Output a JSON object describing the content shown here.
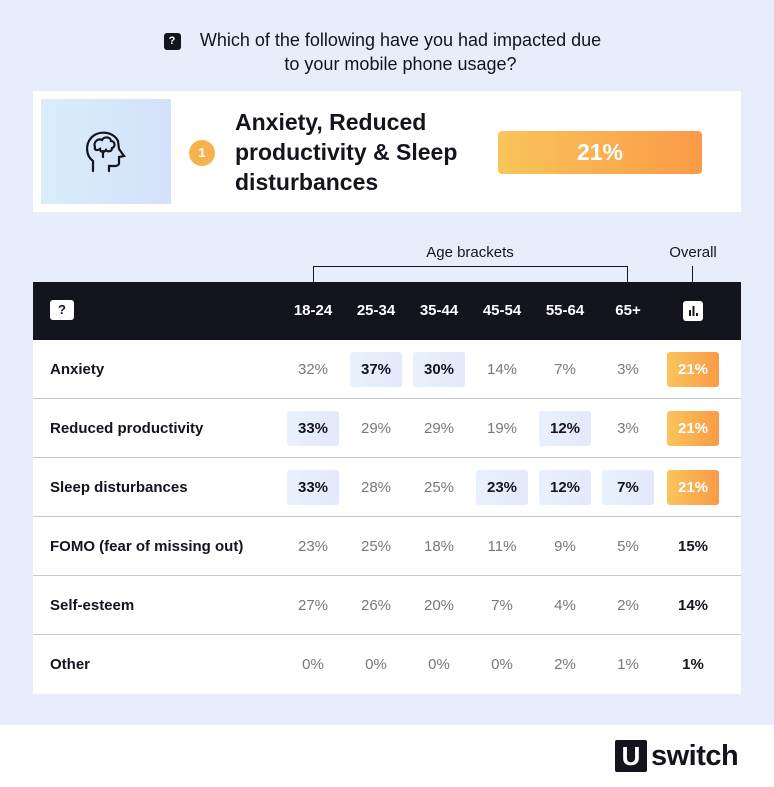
{
  "question": "Which of the following have you had impacted due to your mobile phone usage?",
  "top_result": {
    "rank": "1",
    "title": "Anxiety, Reduced productivity & Sleep disturbances",
    "value": "21%",
    "icon": "brain-head-icon"
  },
  "labels": {
    "age_brackets": "Age brackets",
    "overall": "Overall"
  },
  "colors": {
    "header": "#14141f",
    "highlight": "#e6eefc",
    "overall_gradient_start": "#f9c55a",
    "overall_gradient_end": "#fb9a48"
  },
  "chart_data": {
    "type": "table",
    "columns": [
      "18-24",
      "25-34",
      "35-44",
      "45-54",
      "55-64",
      "65+",
      "Overall"
    ],
    "rows": [
      {
        "label": "Anxiety",
        "values": [
          "32%",
          "37%",
          "30%",
          "14%",
          "7%",
          "3%",
          "21%"
        ],
        "highlighted": [
          false,
          true,
          true,
          false,
          false,
          false,
          true
        ]
      },
      {
        "label": "Reduced productivity",
        "values": [
          "33%",
          "29%",
          "29%",
          "19%",
          "12%",
          "3%",
          "21%"
        ],
        "highlighted": [
          true,
          false,
          false,
          false,
          true,
          false,
          true
        ]
      },
      {
        "label": "Sleep disturbances",
        "values": [
          "33%",
          "28%",
          "25%",
          "23%",
          "12%",
          "7%",
          "21%"
        ],
        "highlighted": [
          true,
          false,
          false,
          true,
          true,
          true,
          true
        ]
      },
      {
        "label": "FOMO (fear of missing out)",
        "values": [
          "23%",
          "25%",
          "18%",
          "11%",
          "9%",
          "5%",
          "15%"
        ],
        "highlighted": [
          false,
          false,
          false,
          false,
          false,
          false,
          false
        ]
      },
      {
        "label": "Self-esteem",
        "values": [
          "27%",
          "26%",
          "20%",
          "7%",
          "4%",
          "2%",
          "14%"
        ],
        "highlighted": [
          false,
          false,
          false,
          false,
          false,
          false,
          false
        ]
      },
      {
        "label": "Other",
        "values": [
          "0%",
          "0%",
          "0%",
          "0%",
          "2%",
          "1%",
          "1%"
        ],
        "highlighted": [
          false,
          false,
          false,
          false,
          false,
          false,
          false
        ]
      }
    ]
  },
  "brand": {
    "logo_letter": "U",
    "logo_text": "switch"
  }
}
